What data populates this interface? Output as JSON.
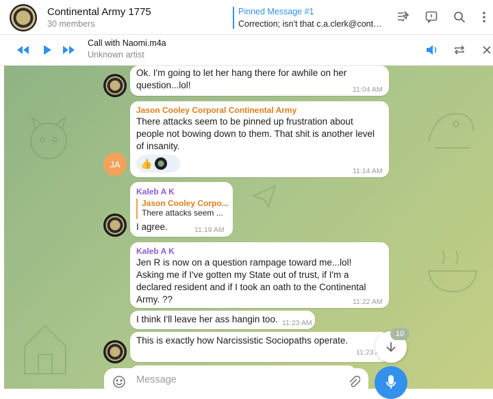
{
  "header": {
    "title": "Continental Army 1775",
    "subtitle": "30 members",
    "pinned_title": "Pinned Message #1",
    "pinned_text": "Correction; isn't that c.a.clerk@conti..."
  },
  "player": {
    "track_title": "Call with Naomi.m4a",
    "track_artist": "Unknown artist"
  },
  "messages": [
    {
      "lines": [
        "Ok. I'm going to let her hang there for awhile on her",
        "question...lol!"
      ],
      "time": "11:04 AM"
    },
    {
      "sender": "Jason Cooley Corporal Continental Army",
      "lines": [
        "There attacks seem to be pinned up frustration about",
        "people not bowing down to them. That shit is another level",
        "of insanity."
      ],
      "reactions": [
        "👍",
        "●"
      ],
      "time": "11:14 AM",
      "avatar_initials": "JA"
    },
    {
      "sender": "Kaleb A K",
      "reply_sender": "Jason Cooley Corpo...",
      "reply_text": "There attacks seem ...",
      "lines": [
        "I agree."
      ],
      "time": "11:19 AM"
    },
    {
      "sender": "Kaleb A K",
      "lines": [
        "Jen R is now on a question rampage toward me...lol!",
        "Asking me if I've gotten my State out of trust, if I'm a",
        "declared resident and if I took an oath to the Continental",
        "Army. ??"
      ],
      "time": "11:22 AM"
    },
    {
      "lines": [
        "I think I'll leave her ass hangin too."
      ],
      "time": "11:23 AM"
    },
    {
      "lines": [
        "This is exactly how Narcissistic Sociopaths operate."
      ],
      "time": "11:23 A"
    }
  ],
  "scroll": {
    "unread_count": "10"
  },
  "composer": {
    "placeholder": "Message"
  },
  "colors": {
    "accent": "#3390ec",
    "sender_orange": "#e07f1c",
    "sender_purple": "#8c5bd6",
    "reaction_bg": "#eaf1fb"
  },
  "icons": [
    "pin-list-icon",
    "comments-icon",
    "search-icon",
    "more-icon",
    "rewind-icon",
    "play-icon",
    "fast-forward-icon",
    "volume-icon",
    "repeat-icon",
    "close-icon",
    "arrow-down-icon",
    "emoji-icon",
    "attach-icon",
    "mic-icon"
  ]
}
